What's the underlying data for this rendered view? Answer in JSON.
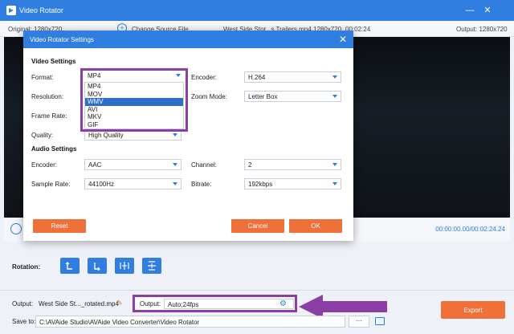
{
  "app": {
    "title": "Video Rotator",
    "minimize": "—",
    "close": "✕"
  },
  "info": {
    "original": "Original: 1280x720",
    "change_source": "Change Source File",
    "file_name": "West Side Stor...s Trailers.mp4",
    "resolution": "1280x720",
    "duration": "00:02:24",
    "output_res": "Output: 1280x720"
  },
  "player": {
    "time": "00:00:00.00/00:02:24.24"
  },
  "rotation": {
    "label": "Rotation:"
  },
  "bottom": {
    "output_label": "Output:",
    "output_file": "West Side St..._rotated.mp4",
    "output_box_label": "Output:",
    "output_box_value": "Auto;24fps",
    "export": "Export",
    "save_to_label": "Save to:",
    "save_path": "C:\\AVAide Studio\\AVAide Video Converter\\Video Rotator",
    "browse": "···"
  },
  "dialog": {
    "title": "Video Rotator Settings",
    "close": "✕",
    "video_settings": "Video Settings",
    "format_label": "Format:",
    "format_value": "MP4",
    "format_options": [
      "MP4",
      "MOV",
      "WMV",
      "AVI",
      "MKV",
      "GIF"
    ],
    "format_highlighted": "WMV",
    "resolution_label": "Resolution:",
    "frame_rate_label": "Frame Rate:",
    "quality_label": "Quality:",
    "quality_value": "High Quality",
    "encoder_label": "Encoder:",
    "encoder_value": "H.264",
    "zoom_label": "Zoom Mode:",
    "zoom_value": "Letter Box",
    "audio_settings": "Audio Settings",
    "a_encoder_label": "Encoder:",
    "a_encoder_value": "AAC",
    "channel_label": "Channel:",
    "channel_value": "2",
    "sample_rate_label": "Sample Rate:",
    "sample_rate_value": "44100Hz",
    "bitrate_label": "Bitrate:",
    "bitrate_value": "192kbps",
    "reset": "Reset",
    "cancel": "Cancel",
    "ok": "OK"
  },
  "colors": {
    "accent": "#2f7ee0",
    "button": "#f0703a",
    "highlight": "#8a3ea6"
  }
}
